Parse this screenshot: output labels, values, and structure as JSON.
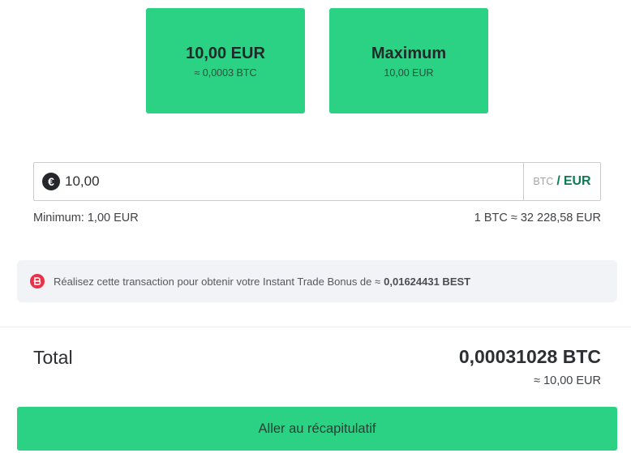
{
  "quick_amounts": {
    "left": {
      "main": "10,00 EUR",
      "sub": "≈ 0,0003 BTC"
    },
    "right": {
      "main": "Maximum",
      "sub": "10,00 EUR"
    }
  },
  "amount_input": {
    "currency_symbol": "€",
    "value": "10,00",
    "currency_inactive": "BTC",
    "separator": "/",
    "currency_active": "EUR"
  },
  "limits": {
    "minimum": "Minimum: 1,00 EUR",
    "rate": "1 BTC ≈ 32 228,58 EUR"
  },
  "bonus": {
    "icon": "best-token-icon",
    "text": "Réalisez cette transaction pour obtenir votre Instant Trade Bonus de ≈",
    "value": "0,01624431 BEST"
  },
  "total": {
    "label": "Total",
    "btc": "0,00031028 BTC",
    "eur": "≈ 10,00 EUR"
  },
  "cta": {
    "label": "Aller au récapitulatif"
  },
  "colors": {
    "accent_green": "#2bd283",
    "active_currency": "#0f7a55",
    "bonus_icon": "#e8324a"
  }
}
